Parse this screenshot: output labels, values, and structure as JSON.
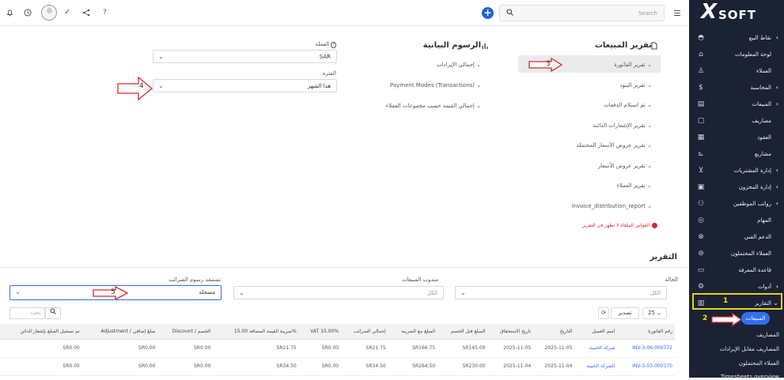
{
  "topbar": {
    "icons": [
      "bell-icon",
      "clock-icon",
      "avatar",
      "check-icon",
      "share-icon",
      "help-icon"
    ],
    "check": "✓",
    "help": "?",
    "search_placeholder": "Search",
    "plus": "+"
  },
  "logo": {
    "text": "SOFT",
    "mark": "X"
  },
  "sidebar": {
    "items": [
      {
        "label": "نقاط البيع",
        "icon": "basket-icon",
        "chev": "‹"
      },
      {
        "label": "لوحة المعلومات",
        "icon": "home-icon",
        "chev": ""
      },
      {
        "label": "العملاء",
        "icon": "user-icon",
        "chev": ""
      },
      {
        "label": "المحاسبة",
        "icon": "dollar-icon",
        "chev": "‹"
      },
      {
        "label": "المبيعات",
        "icon": "receipt-icon",
        "chev": "‹"
      },
      {
        "label": "مصاريف",
        "icon": "file-icon",
        "chev": ""
      },
      {
        "label": "العقود",
        "icon": "doc-icon",
        "chev": ""
      },
      {
        "label": "مشاريع",
        "icon": "chart-icon",
        "chev": ""
      },
      {
        "label": "إدارة المشتريات",
        "icon": "cart-icon",
        "chev": "‹"
      },
      {
        "label": "إدارة المخزون",
        "icon": "box-icon",
        "chev": "‹"
      },
      {
        "label": "رواتب الموظفين",
        "icon": "users-icon",
        "chev": "‹"
      },
      {
        "label": "المهام",
        "icon": "check-circle-icon",
        "chev": ""
      },
      {
        "label": "الدعم الفني",
        "icon": "support-icon",
        "chev": ""
      },
      {
        "label": "العملاء المحتملون",
        "icon": "lead-icon",
        "chev": ""
      },
      {
        "label": "قاعدة المعرفة",
        "icon": "folder-icon",
        "chev": ""
      },
      {
        "label": "أدوات",
        "icon": "tools-icon",
        "chev": "‹"
      },
      {
        "label": "التقارير",
        "icon": "reports-icon",
        "chev": "⌄"
      }
    ],
    "sub_items": [
      "المبيعات",
      "المصاريف",
      "المصاريف مقابل الإيرادات",
      "العملاء المحتملون",
      "Timesheets overview"
    ]
  },
  "annotations": {
    "a1": "1",
    "a2": "2",
    "a3": "3",
    "a4": "4",
    "a5": "5"
  },
  "sales": {
    "title": "تقرير المبيعات",
    "items": [
      "تقرير الفاتورة",
      "تقرير البنود",
      "تم استلام الدفعات",
      "تقرير الإشعارات الدائنة",
      "تقرير عروض الأسعار المحتملة",
      "تقرير عروض الأسعار",
      "تقرير العملاء",
      "invoice_distribution_report"
    ],
    "warning": "الفواتير الملغاة لا تظهر في التقرير"
  },
  "charts": {
    "title": "الرسوم البيانية",
    "items": [
      "إجمالي الإيرادات",
      "Payment Modes (Transactions)",
      "إجمالي القيمة حسب مجموعات العملاء"
    ]
  },
  "filters": {
    "currency_label": "العملة",
    "currency_value": "SAR",
    "period_label": "الفترة",
    "period_value": "هذا الشهر"
  },
  "report": {
    "title": "التقرير",
    "status_label": "الحالة",
    "status_value": "الكل",
    "agent_label": "مندوب المبيعات",
    "agent_value": "الكل",
    "tax_label": "تستبعد رسوم الضرائب",
    "tax_value": "مسجلة",
    "export": "تصدير",
    "page_size": "25",
    "search_placeholder": "بحث",
    "refresh": "⟳"
  },
  "table": {
    "headers": [
      "رقم الفاتورة",
      "اسم العميل",
      "التاريخ",
      "تاريخ الاستحقاق",
      "المبلغ قبل الخصم",
      "المبلغ مع الضريبة",
      "إجمالي الضرائب",
      "VAT 15.00%",
      "ضريبة القيمة المضافة 15.00%",
      "Discount / الخصم",
      "Adjustment / مبلغ إضافي",
      "تم تسجيل المبلغ بإشعار الدائن"
    ],
    "rows": [
      [
        "INV-3-06-000372",
        "شركة الخبيبة",
        "2025-11-05",
        "2025-11-05",
        "SR145.00",
        "SR166.75",
        "SR21.75",
        "SR0.00",
        "SR21.75",
        "SR0.00",
        "SR0.00",
        "SR0.00"
      ],
      [
        "INV-3-03-000370",
        "الشركة الخبيبة",
        "2025-11-04",
        "2025-11-04",
        "SR230.00",
        "SR264.50",
        "SR34.50",
        "SR0.00",
        "SR34.50",
        "SR0.00",
        "SR0.00",
        "SR0.00"
      ]
    ]
  }
}
